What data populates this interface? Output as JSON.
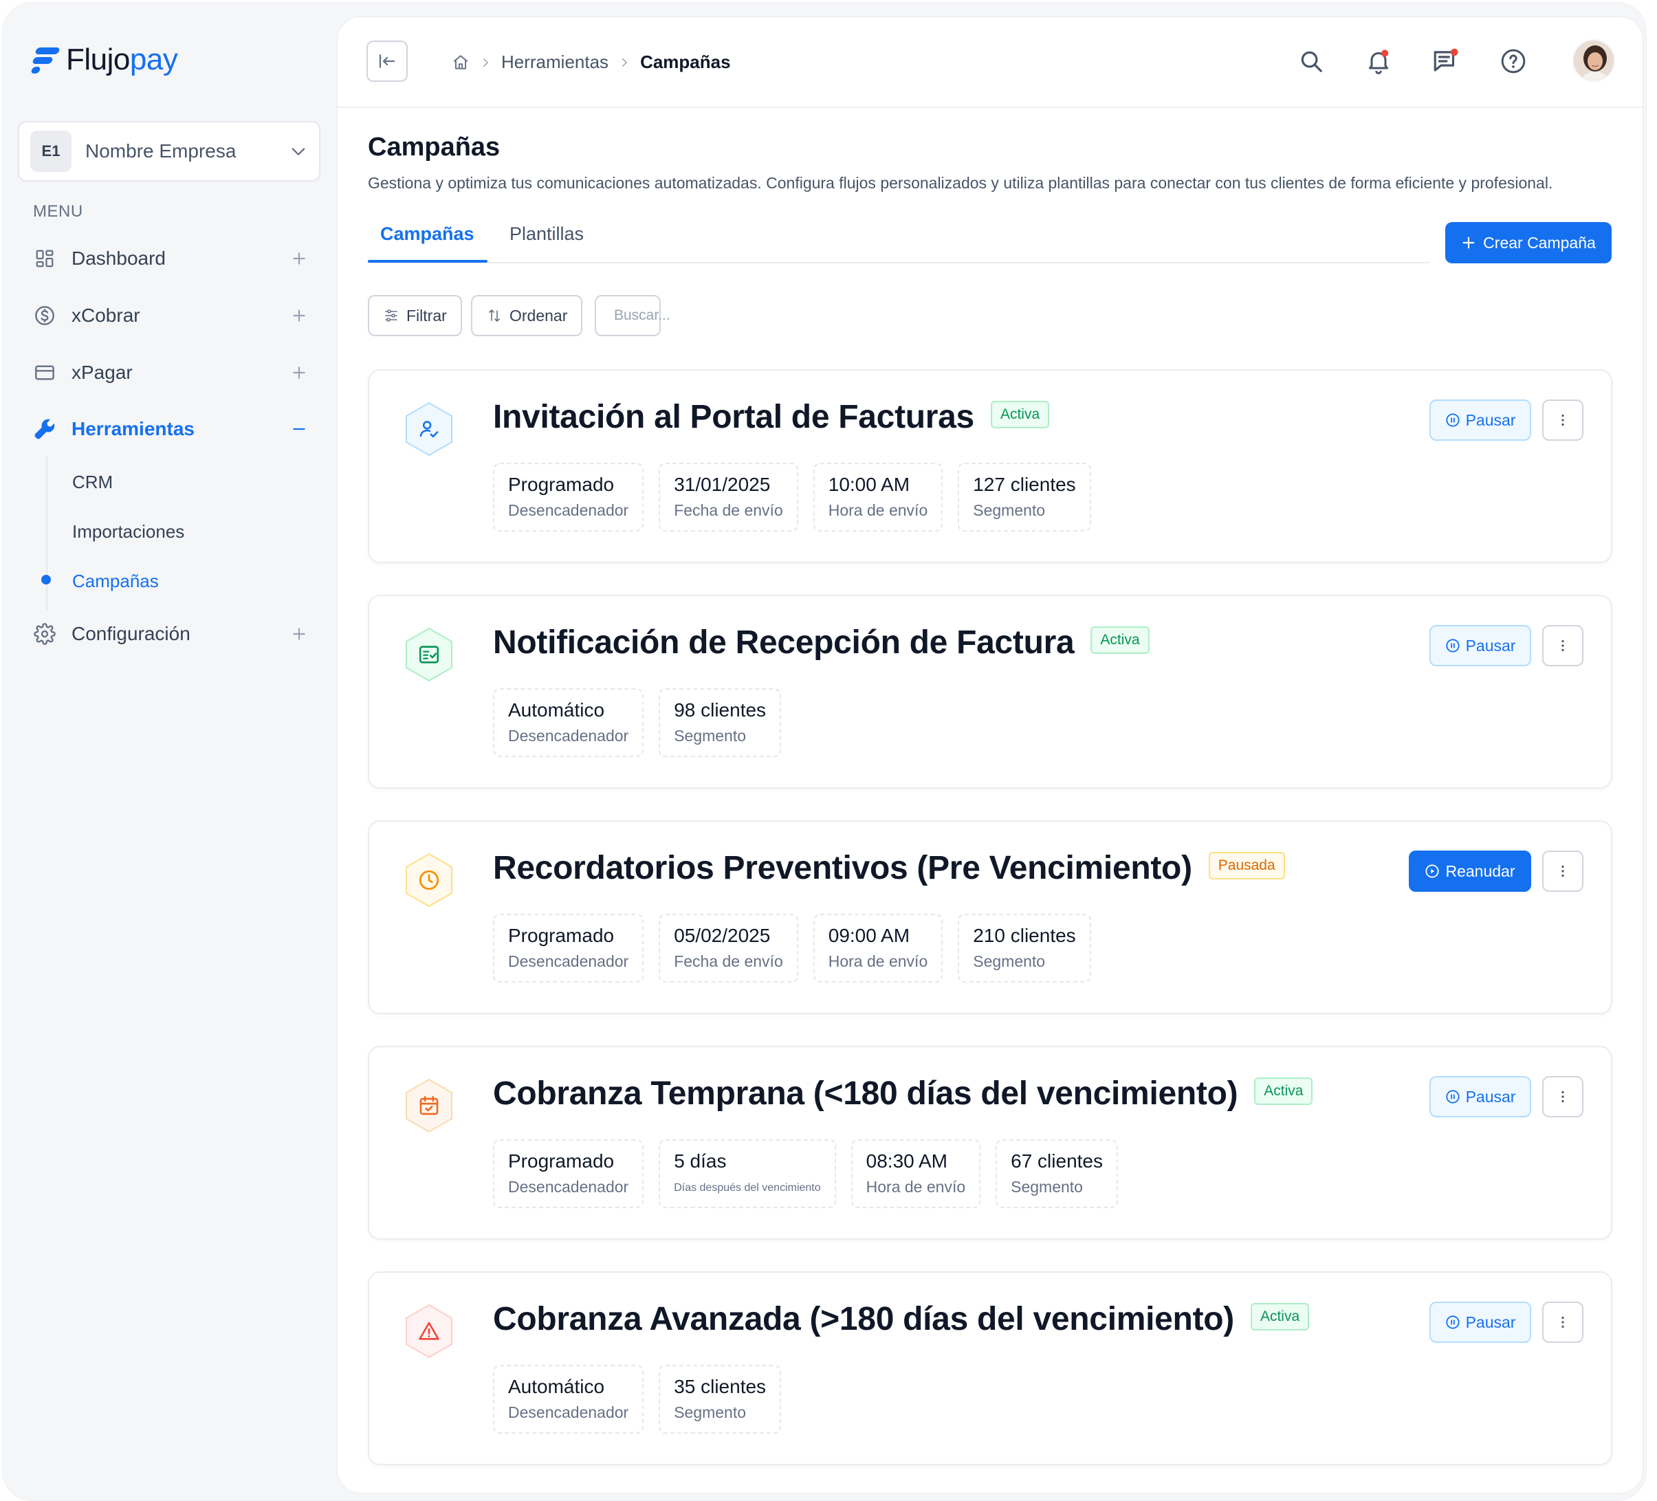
{
  "brand": {
    "name_part1": "Flujo",
    "name_part2": "pay",
    "color": "#1570ef"
  },
  "company": {
    "initials": "E1",
    "name": "Nombre Empresa"
  },
  "sidebar": {
    "menu_label": "MENU",
    "items": [
      {
        "label": "Dashboard",
        "icon": "dashboard-icon"
      },
      {
        "label": "xCobrar",
        "icon": "dollar-circle-icon"
      },
      {
        "label": "xPagar",
        "icon": "credit-card-icon"
      },
      {
        "label": "Herramientas",
        "icon": "wrench-icon"
      },
      {
        "label": "Configuración",
        "icon": "gear-icon"
      }
    ],
    "subitems": [
      {
        "label": "CRM"
      },
      {
        "label": "Importaciones"
      },
      {
        "label": "Campañas"
      }
    ]
  },
  "breadcrumb": {
    "items": [
      "Herramientas",
      "Campañas"
    ]
  },
  "page": {
    "title": "Campañas",
    "subtitle": "Gestiona y optimiza tus comunicaciones automatizadas. Configura flujos personalizados y utiliza plantillas para conectar con tus clientes de forma eficiente y profesional."
  },
  "tabs": [
    {
      "label": "Campañas"
    },
    {
      "label": "Plantillas"
    }
  ],
  "toolbar": {
    "create_label": "Crear Campaña",
    "filter_label": "Filtrar",
    "sort_label": "Ordenar",
    "search_placeholder": "Buscar..."
  },
  "campaigns": [
    {
      "title": "Invitación al Portal de Facturas",
      "status": "Activa",
      "action": "Pausar",
      "icon": "user-check-icon",
      "metrics": [
        {
          "value": "Programado",
          "label": "Desencadenador"
        },
        {
          "value": "31/01/2025",
          "label": "Fecha de envío"
        },
        {
          "value": "10:00 AM",
          "label": "Hora de envío"
        },
        {
          "value": "127 clientes",
          "label": "Segmento"
        }
      ]
    },
    {
      "title": "Notificación de Recepción de Factura",
      "status": "Activa",
      "action": "Pausar",
      "icon": "invoice-check-icon",
      "metrics": [
        {
          "value": "Automático",
          "label": "Desencadenador"
        },
        {
          "value": "98 clientes",
          "label": "Segmento"
        }
      ]
    },
    {
      "title": "Recordatorios Preventivos (Pre Vencimiento)",
      "status": "Pausada",
      "action": "Reanudar",
      "icon": "clock-icon",
      "metrics": [
        {
          "value": "Programado",
          "label": "Desencadenador"
        },
        {
          "value": "05/02/2025",
          "label": "Fecha de envío"
        },
        {
          "value": "09:00 AM",
          "label": "Hora de envío"
        },
        {
          "value": "210 clientes",
          "label": "Segmento"
        }
      ]
    },
    {
      "title": "Cobranza Temprana (<180 días del vencimiento)",
      "status": "Activa",
      "action": "Pausar",
      "icon": "calendar-check-icon",
      "metrics": [
        {
          "value": "Programado",
          "label": "Desencadenador"
        },
        {
          "value": "5 días",
          "label": "Días después del vencimiento"
        },
        {
          "value": "08:30 AM",
          "label": "Hora de envío"
        },
        {
          "value": "67 clientes",
          "label": "Segmento"
        }
      ]
    },
    {
      "title": "Cobranza Avanzada (>180 días del vencimiento)",
      "status": "Activa",
      "action": "Pausar",
      "icon": "warning-triangle-icon",
      "metrics": [
        {
          "value": "Automático",
          "label": "Desencadenador"
        },
        {
          "value": "35 clientes",
          "label": "Segmento"
        }
      ]
    }
  ],
  "colors": {
    "primary": "#1570ef",
    "active_badge": "#079455",
    "paused_badge": "#dc6803",
    "notification_dot": "#f04438"
  }
}
